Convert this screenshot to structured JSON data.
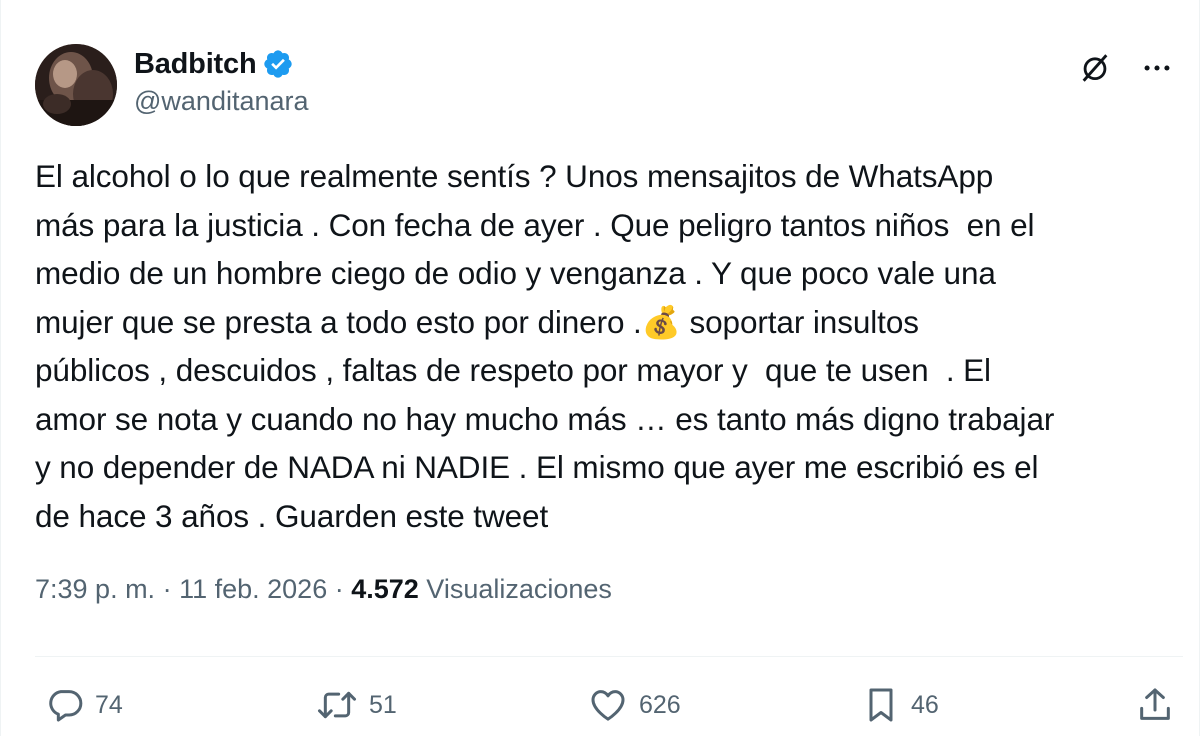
{
  "author": {
    "display_name": "Badbitch",
    "handle": "@wanditanara",
    "verified_icon": "verified-badge-icon",
    "avatar_icon": "avatar"
  },
  "header_actions": {
    "grok_icon": "grok-slash-circle-icon",
    "more_icon": "more-ellipsis-icon"
  },
  "tweet": {
    "text": "El alcohol o lo que realmente sentís ? Unos mensajitos de WhatsApp\nmás para la justicia . Con fecha de ayer . Que peligro tantos niños  en el\nmedio de un hombre ciego de odio y venganza . Y que poco vale una\nmujer que se presta a todo esto por dinero .💰 soportar insultos\npúblicos , descuidos , faltas de respeto por mayor y  que te usen  . El\namor se nota y cuando no hay mucho más … es tanto más digno trabajar\ny no depender de NADA ni NADIE . El mismo que ayer me escribió es el\nde hace 3 años . Guarden este tweet"
  },
  "meta": {
    "time": "7:39 p. m.",
    "sep1": " · ",
    "date": "11 feb. 2026",
    "sep2": " · ",
    "views_count": "4.572",
    "views_label": " Visualizaciones"
  },
  "actions": {
    "replies": "74",
    "retweets": "51",
    "likes": "626",
    "bookmarks": "46"
  },
  "colors": {
    "text": "#0f1419",
    "secondary": "#536471",
    "verified": "#1d9bf0",
    "divider": "#eff3f4"
  }
}
